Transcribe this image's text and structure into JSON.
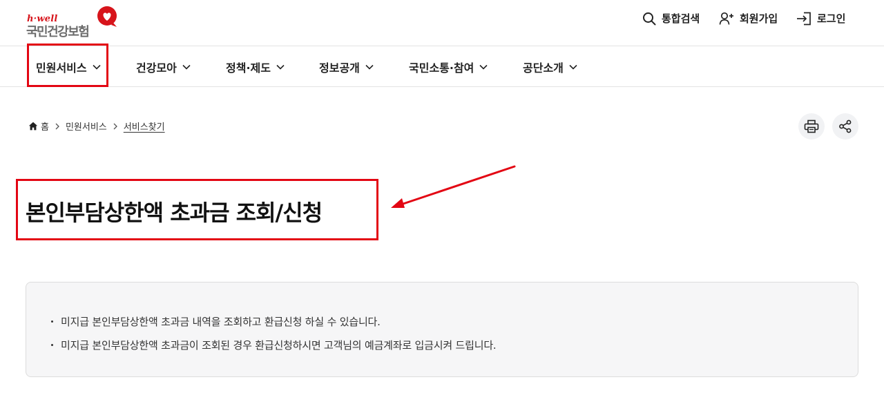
{
  "logo": {
    "brand": "h·well",
    "name": "국민건강보험"
  },
  "utility": {
    "search_label": "통합검색",
    "join_label": "회원가입",
    "login_label": "로그인"
  },
  "nav": {
    "items": [
      {
        "label": "민원서비스",
        "icon": "chevron-down-icon"
      },
      {
        "label": "건강모아",
        "icon": "chevron-down-icon"
      },
      {
        "label": "정책·제도",
        "icon": "chevron-down-icon"
      },
      {
        "label": "정보공개",
        "icon": "chevron-down-icon"
      },
      {
        "label": "국민소통·참여",
        "icon": "chevron-down-icon"
      },
      {
        "label": "공단소개",
        "icon": "chevron-down-icon"
      }
    ]
  },
  "breadcrumb": {
    "home": "홈",
    "level1": "민원서비스",
    "current": "서비스찾기"
  },
  "actions": {
    "print_icon": "print-icon",
    "share_icon": "share-icon"
  },
  "page": {
    "title": "본인부담상한액 초과금 조회/신청"
  },
  "info": {
    "items": [
      "미지급 본인부담상한액 초과금 내역을 조회하고 환급신청 하실 수 있습니다.",
      "미지급 본인부담상한액 초과금이 조회된 경우 환급신청하시면 고객님의 예금계좌로 입금시켜 드립니다."
    ]
  },
  "colors": {
    "brand_red": "#d7141b",
    "highlight_red": "#e30613",
    "info_bg": "#f6f6f7"
  }
}
